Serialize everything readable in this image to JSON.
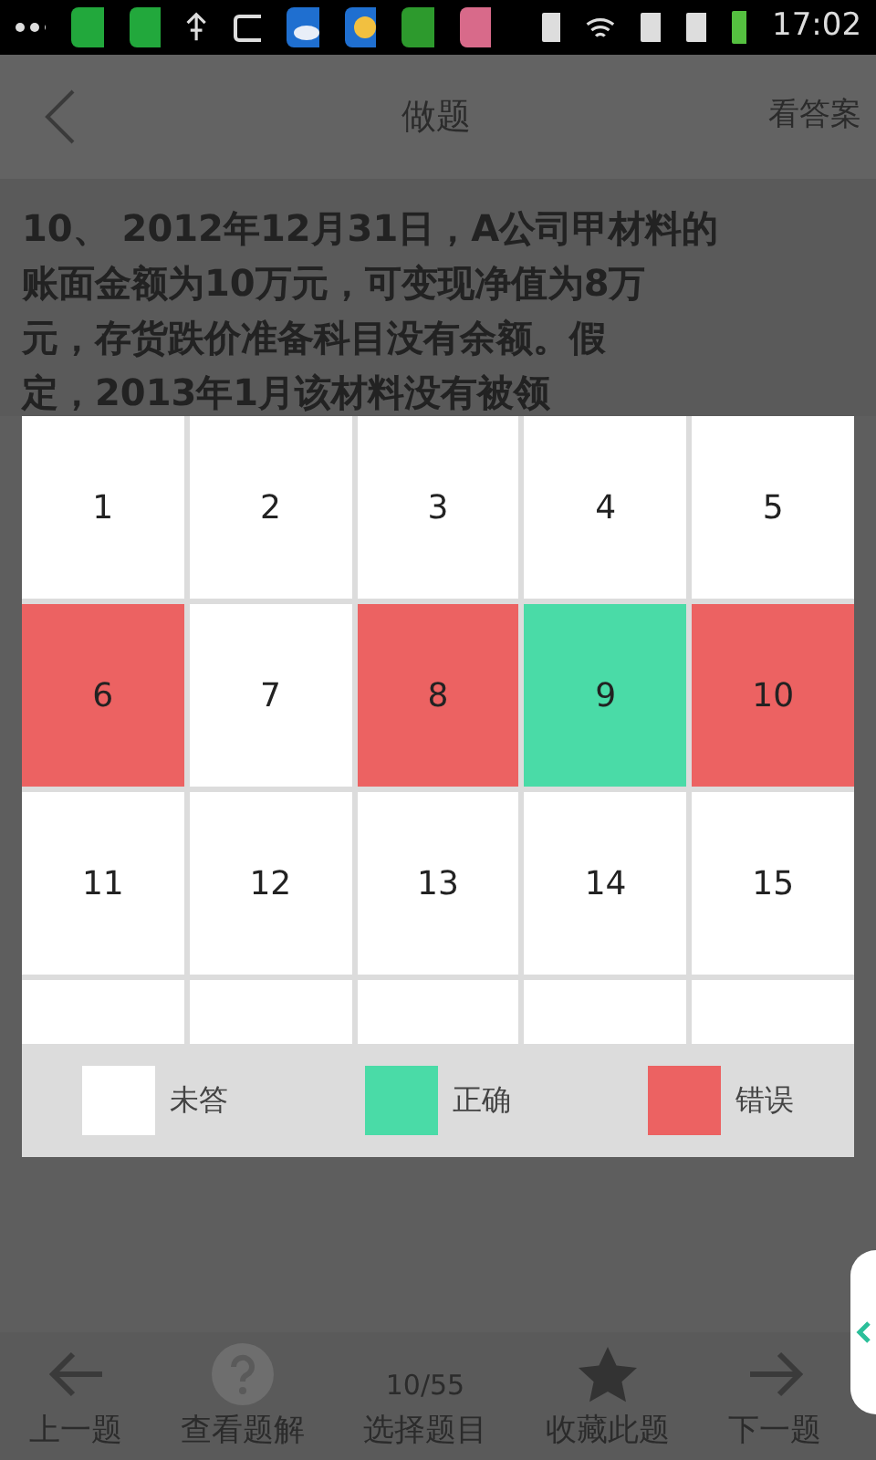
{
  "status_bar": {
    "time": "17:02"
  },
  "header": {
    "title": "做题",
    "action": "看答案"
  },
  "question": {
    "lines": [
      "10、 2012年12月31日，A公司甲材料的",
      "账面金额为10万元，可变现净值为8万",
      "元，存货跌价准备科目没有余额。假",
      "定，2013年1月该材料没有被领"
    ]
  },
  "answer_sheet": {
    "cells": [
      {
        "number": "1",
        "kind": "unanswered"
      },
      {
        "number": "2",
        "kind": "unanswered"
      },
      {
        "number": "3",
        "kind": "unanswered"
      },
      {
        "number": "4",
        "kind": "unanswered"
      },
      {
        "number": "5",
        "kind": "unanswered"
      },
      {
        "number": "6",
        "kind": "wrong"
      },
      {
        "number": "7",
        "kind": "unanswered"
      },
      {
        "number": "8",
        "kind": "wrong"
      },
      {
        "number": "9",
        "kind": "correct"
      },
      {
        "number": "10",
        "kind": "wrong"
      },
      {
        "number": "11",
        "kind": "unanswered"
      },
      {
        "number": "12",
        "kind": "unanswered"
      },
      {
        "number": "13",
        "kind": "unanswered"
      },
      {
        "number": "14",
        "kind": "unanswered"
      },
      {
        "number": "15",
        "kind": "unanswered"
      }
    ],
    "legend": [
      {
        "kind": "unanswered",
        "label": "未答"
      },
      {
        "kind": "correct",
        "label": "正确"
      },
      {
        "kind": "wrong",
        "label": "错误"
      }
    ]
  },
  "bottom_bar": {
    "counter": "10/55",
    "items": [
      {
        "kind": "prev",
        "label": "上一题"
      },
      {
        "kind": "explain",
        "label": "查看题解"
      },
      {
        "kind": "select",
        "label": "选择题目"
      },
      {
        "kind": "favorite",
        "label": "收藏此题"
      },
      {
        "kind": "next",
        "label": "下一题"
      }
    ]
  }
}
